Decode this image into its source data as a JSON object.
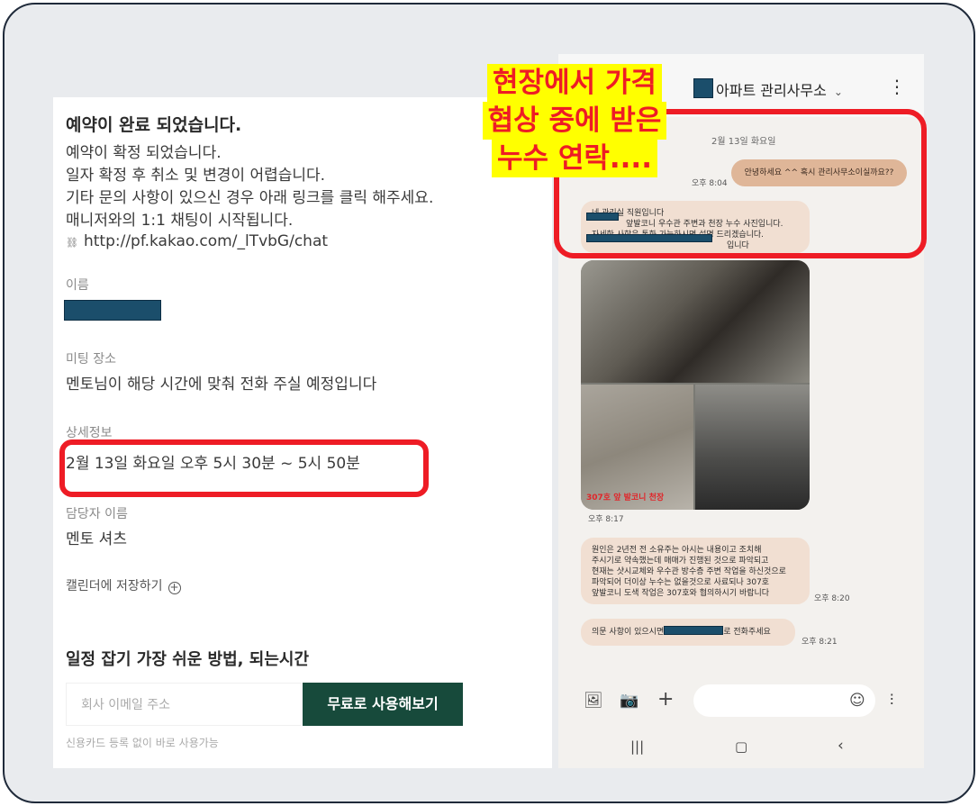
{
  "left": {
    "title": "예약이 완료 되었습니다.",
    "message_lines": [
      "예약이 확정 되었습니다.",
      "일자 확정 후  취소 및 변경이 어렵습니다.",
      "기타 문의 사항이 있으신 경우 아래 링크를 클릭 해주세요.",
      "매니저와의 1:1 채팅이 시작됩니다."
    ],
    "link_icon": "chain-link-icon",
    "link": "http://pf.kakao.com/_lTvbG/chat",
    "name_label": "이름",
    "meeting_place_label": "미팅 장소",
    "meeting_place_value": "멘토님이 해당 시간에 맞춰 전화 주실 예정입니다",
    "detail_label": "상세정보",
    "detail_value": "2월 13일 화요일 오후 5시 30분 ~ 5시 50분",
    "manager_label": "담당자 이름",
    "manager_value": "멘토 셔츠",
    "calendar_save": "캘린더에 저장하기",
    "promo_title": "일정 잡기 가장 쉬운 방법, 되는시간",
    "email_placeholder": "회사 이메일 주소",
    "free_button": "무료로 사용해보기",
    "note": "신용카드 등록 없이 바로 사용가능"
  },
  "overlay": {
    "lines": [
      "현장에서 가격",
      "협상 중에 받은",
      "누수 연락...."
    ],
    "text_color": "#ee1c25",
    "highlight_color": "#ffff00",
    "oval_color": "#ee1c25"
  },
  "chat": {
    "title": "아파트 관리사무소",
    "date": "2월 13일 화요일",
    "my_message": "안녕하세요 ^^ 혹시 관리사무소이실까요??",
    "my_message_time": "오후 8:04",
    "reply1_lines": [
      "네 관리실 직원입니다",
      "앞발코니 우수관 주변과 천장 누수 사진입니다.",
      "자세한 사항은 통화 가능하시면 설명 드리겠습니다.",
      "입니다"
    ],
    "photo_caption": "307호 앞 발코니 천장",
    "photo_time": "오후 8:17",
    "reply2_lines": [
      "원인은 2년전 전 소유주는 아시는 내용이고  조치해",
      "주시기로 약속했는데 매매가 진행된 것으로 파악되고",
      "현재는 샷시교체와 우수관 방수층 주변 작업을 하신것으로",
      "파악되어 더이상 누수는 없을것으로 사료되나 307호",
      "앞발코니 도색 작업은 307호와 협의하시기 바랍니다"
    ],
    "reply2_time": "오후 8:20",
    "reply3_start": "의문 사항이 있으시면",
    "reply3_end": "로 전화주세요",
    "reply3_time": "오후 8:21",
    "my_bubble_color": "#dfb698",
    "other_bubble_color": "#f1dfd2"
  }
}
